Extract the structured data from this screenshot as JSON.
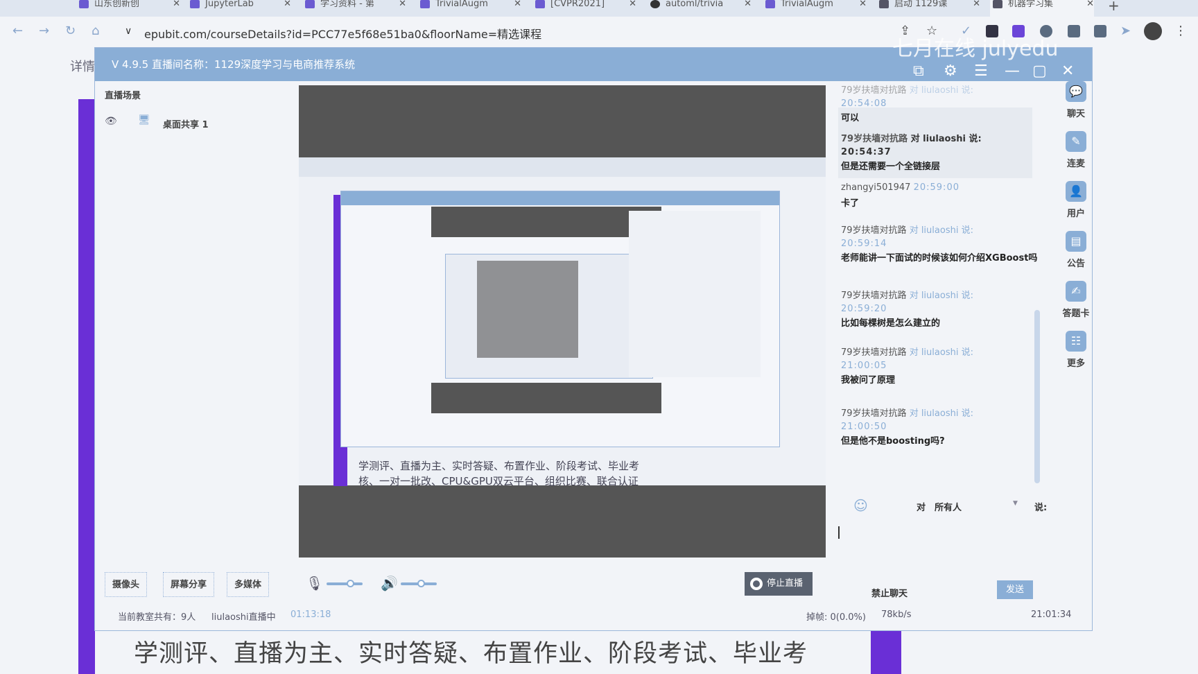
{
  "browser": {
    "tabs": [
      {
        "label": "山东创新创"
      },
      {
        "label": "JupyterLab"
      },
      {
        "label": "学习资料 - 第"
      },
      {
        "label": "TrivialAugm"
      },
      {
        "label": "[CVPR2021]"
      },
      {
        "label": "automl/trivia"
      },
      {
        "label": "TrivialAugm"
      },
      {
        "label": "启动 1129课"
      },
      {
        "label": "机器学习集"
      }
    ],
    "new_tab": "+",
    "url": "epubit.com/courseDetails?id=PCC77e5f68e51ba0&floorName=精选课程",
    "behind_label": "详情"
  },
  "app": {
    "title": "V 4.9.5  直播间名称：1129深度学习与电商推荐系统",
    "watermark": "七月在线 julyedu",
    "scene_title": "直播场景",
    "scene_item": "桌面共享 1",
    "shared_text": [
      "学测评、直播为主、实时答疑、布置作业、阶段考试、毕业考",
      "核、一对一批改、CPU&GPU双云平台、组织比赛、联合认证"
    ],
    "controls": {
      "camera": "摄像头",
      "screen_share": "屏幕分享",
      "media": "多媒体",
      "mic_level": 0.65,
      "speaker_level": 0.55,
      "stop_live": "停止直播"
    },
    "status": {
      "online": "当前教室共有：9人",
      "live": "liulaoshi直播中",
      "duration": "01:13:18",
      "dropped": "掉帧: 0(0.0%)",
      "bitrate": "78kb/s",
      "clock": "21:01:34"
    },
    "chat": {
      "messages": [
        {
          "from": "79岁扶墙对抗路",
          "to": "对 liulaoshi 说:",
          "time": "20:54:08",
          "text": "可以"
        },
        {
          "from": "79岁扶墙对抗路",
          "to": "对 liulaoshi 说:",
          "time": "20:54:37",
          "text": "但是还需要一个全链接层"
        },
        {
          "from": "zhangyi501947",
          "to": "",
          "time": "20:59:00",
          "text": "卡了"
        },
        {
          "from": "79岁扶墙对抗路",
          "to": "对 liulaoshi 说:",
          "time": "20:59:14",
          "text": "老师能讲一下面试的时候该如何介绍XGBoost吗"
        },
        {
          "from": "79岁扶墙对抗路",
          "to": "对 liulaoshi 说:",
          "time": "20:59:20",
          "text": "比如每棵树是怎么建立的"
        },
        {
          "from": "79岁扶墙对抗路",
          "to": "对 liulaoshi 说:",
          "time": "21:00:05",
          "text": "我被问了原理"
        },
        {
          "from": "79岁扶墙对抗路",
          "to": "对 liulaoshi 说:",
          "time": "21:00:50",
          "text": "但是他不是boosting吗?"
        }
      ],
      "to_label": "对",
      "target": "所有人",
      "say_label": "说:",
      "mute": "禁止聊天",
      "send": "发送"
    },
    "rail": [
      {
        "label": "聊天",
        "icon": "chat-icon"
      },
      {
        "label": "连麦",
        "icon": "mic-link-icon"
      },
      {
        "label": "用户",
        "icon": "user-icon"
      },
      {
        "label": "公告",
        "icon": "notice-icon"
      },
      {
        "label": "答题卡",
        "icon": "answer-card-icon"
      },
      {
        "label": "更多",
        "icon": "more-icon"
      }
    ]
  },
  "page_behind_text": [
    "学测评、直播为主、实时答疑、布置作业、阶段考试、毕业考"
  ]
}
